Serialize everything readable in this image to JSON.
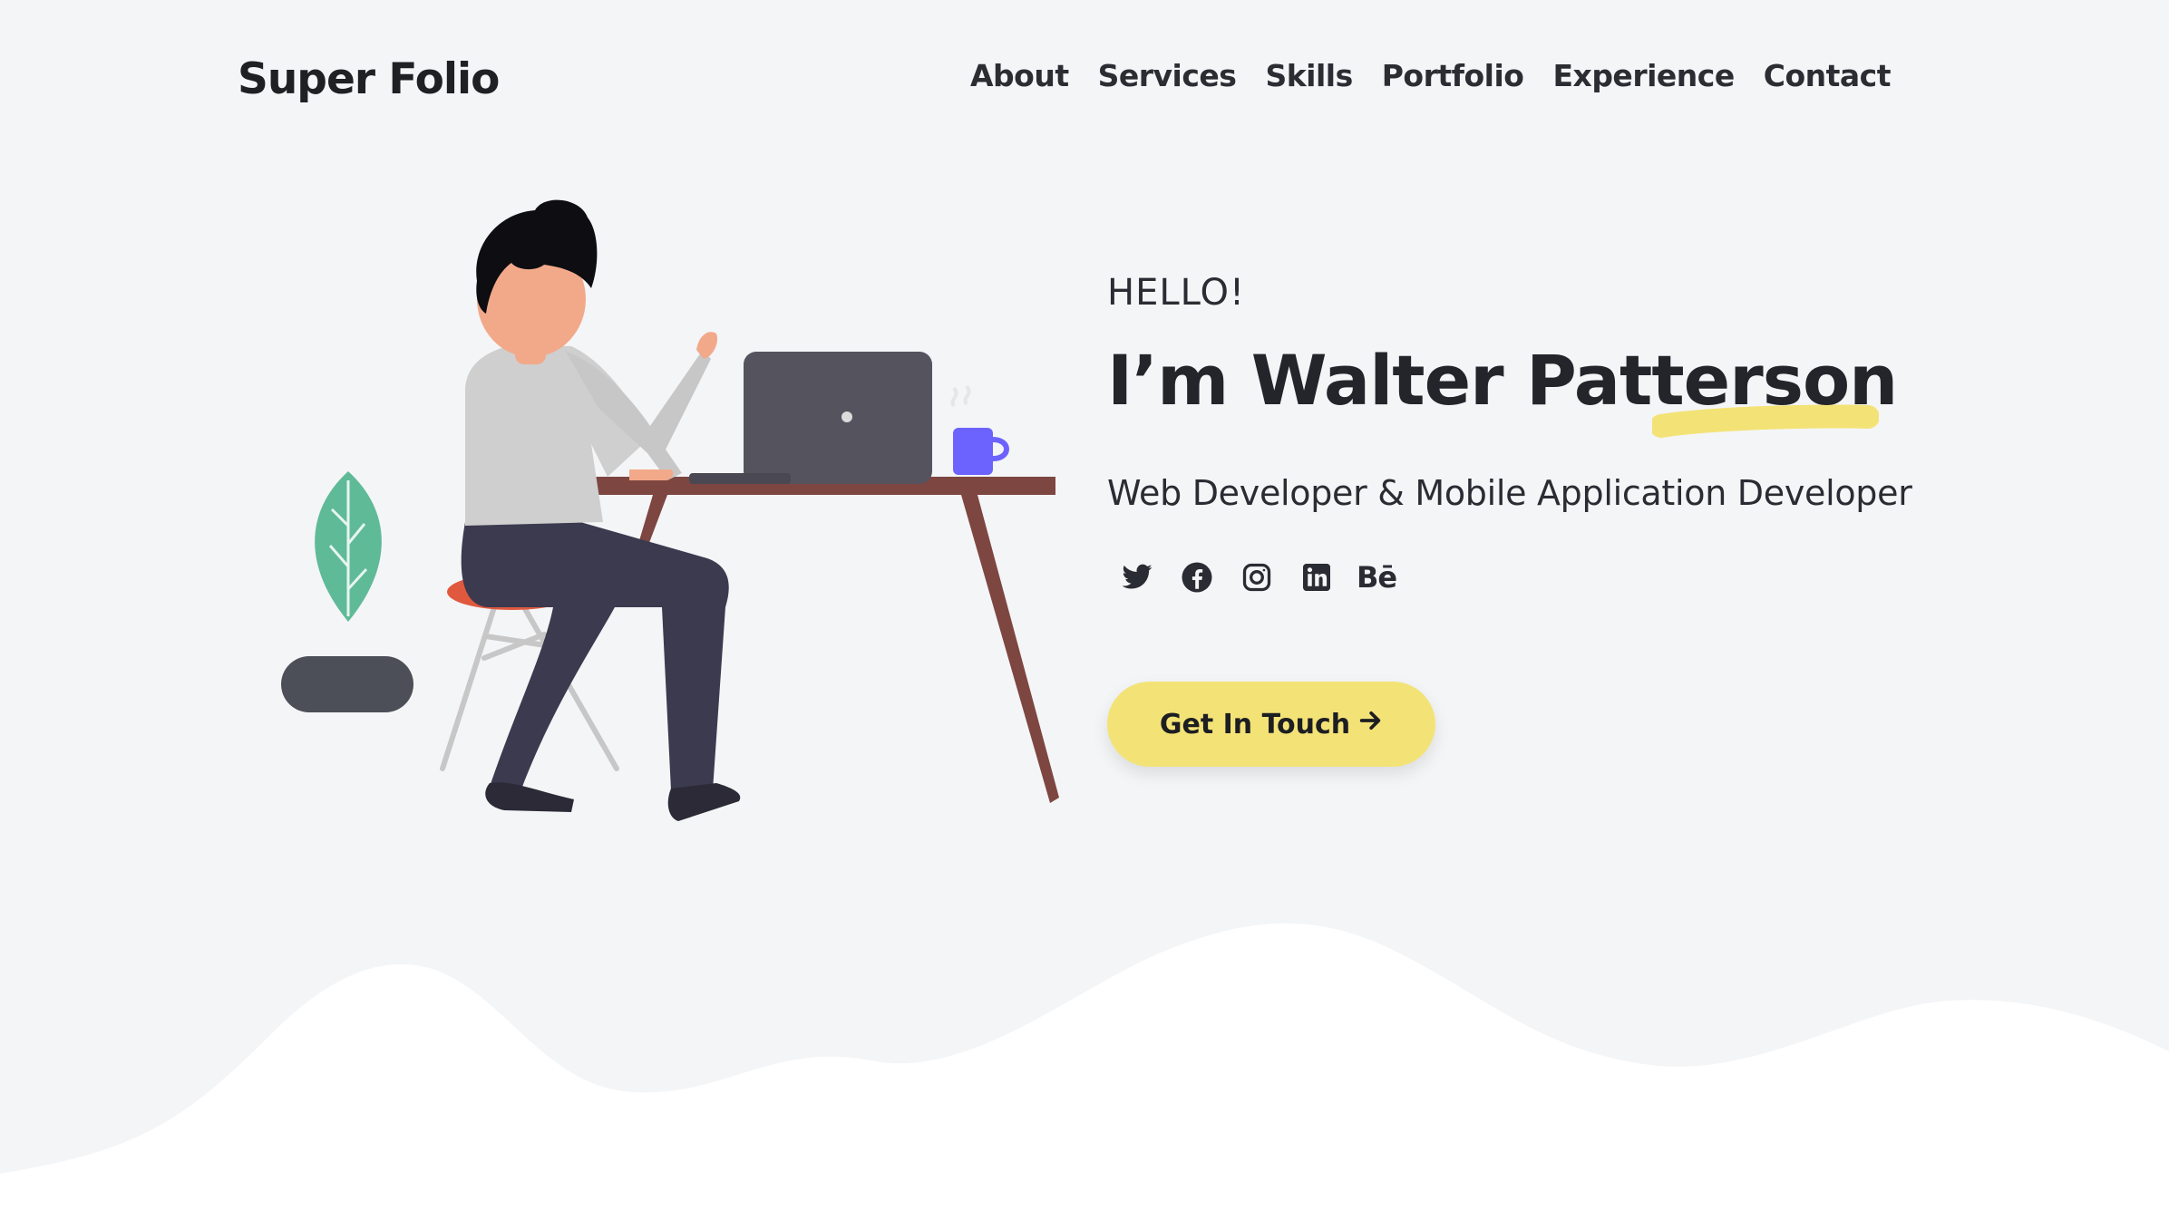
{
  "header": {
    "brand": "Super Folio",
    "nav": [
      "About",
      "Services",
      "Skills",
      "Portfolio",
      "Experience",
      "Contact"
    ]
  },
  "hero": {
    "greeting": "HELLO!",
    "name": "I’m Walter Patterson",
    "role": "Web Developer & Mobile Application Developer",
    "socials": [
      {
        "name": "twitter",
        "icon": "twitter-icon"
      },
      {
        "name": "facebook",
        "icon": "facebook-icon"
      },
      {
        "name": "instagram",
        "icon": "instagram-icon"
      },
      {
        "name": "linkedin",
        "icon": "linkedin-icon"
      },
      {
        "name": "behance",
        "icon": "behance-icon",
        "text": "Bē"
      }
    ],
    "cta_label": "Get In Touch",
    "cta_icon": "arrow-right-icon"
  },
  "colors": {
    "background": "#f4f5f7",
    "accent_yellow": "#f3e377",
    "text_dark": "#23252b",
    "mug": "#6c63ff",
    "desk": "#7e4641",
    "plant": "#5fba98"
  }
}
